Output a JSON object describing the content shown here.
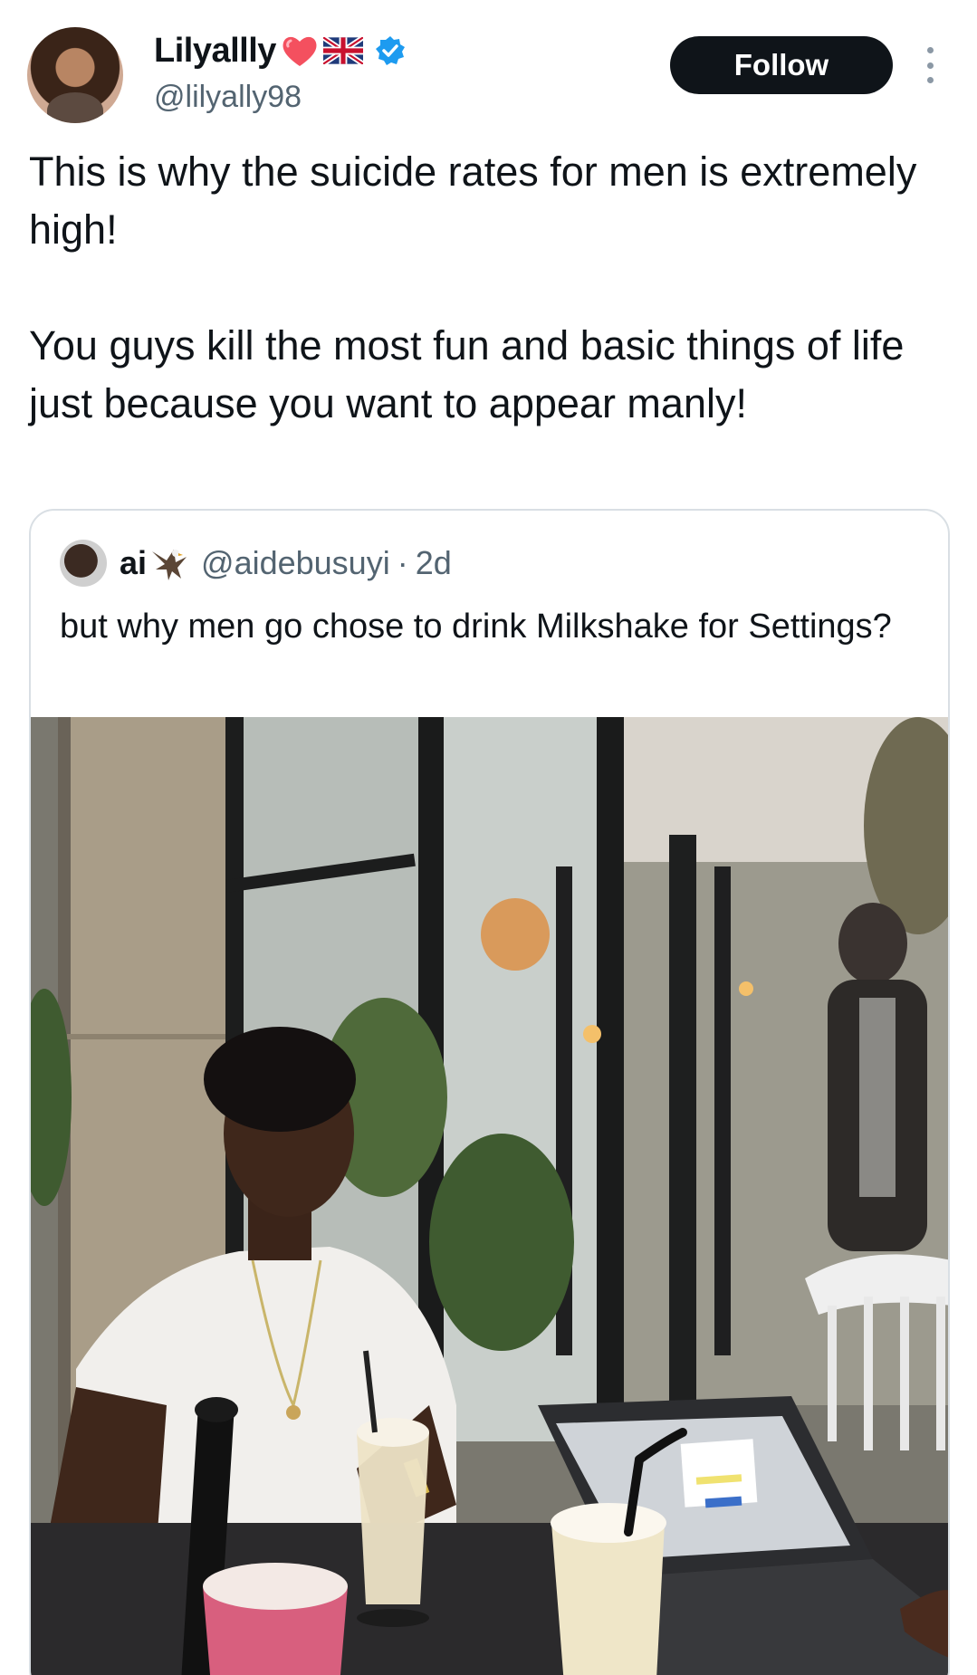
{
  "author": {
    "display_name": "Lilyallly",
    "handle": "@lilyally98",
    "emoji_icons": [
      "heart-icon",
      "uk-flag-icon"
    ],
    "verified_icon": "verified-badge-icon",
    "verified_color": "#1d9bf0"
  },
  "follow_button": {
    "label": "Follow"
  },
  "more_menu": {
    "icon": "more-vertical-icon"
  },
  "tweet": {
    "text": "This is why the suicide rates for men is extremely high!\n\nYou guys kill the most fun and basic things of life just because you want to appear manly!"
  },
  "quoted_tweet": {
    "name": "ai",
    "name_icon": "eagle-icon",
    "handle": "@aidebusuyi",
    "separator": "·",
    "time": "2d",
    "text": "but why men go chose to drink Milkshake for Settings?",
    "photo": "man-in-white-tshirt-at-cafe-with-milkshakes-and-laptop"
  }
}
